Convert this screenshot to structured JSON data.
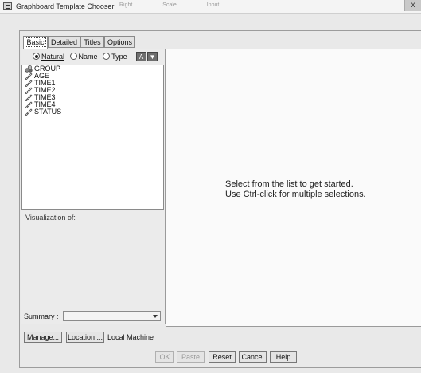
{
  "window": {
    "title": "Graphboard Template Chooser",
    "close_label": "x",
    "background_headers": [
      "Right",
      "Scale",
      "Input"
    ]
  },
  "tabs": [
    {
      "label": "Basic",
      "active": true
    },
    {
      "label": "Detailed",
      "active": false
    },
    {
      "label": "Titles",
      "active": false
    },
    {
      "label": "Options",
      "active": false
    }
  ],
  "sort": {
    "natural_label": "Natural",
    "name_label": "Name",
    "type_label": "Type",
    "selected": "Natural",
    "button_a": "A",
    "button_b": "▼"
  },
  "variables": [
    {
      "name": "GROUP",
      "icon": "nominal-icon"
    },
    {
      "name": "AGE",
      "icon": "scale-icon"
    },
    {
      "name": "TIME1",
      "icon": "scale-icon"
    },
    {
      "name": "TIME2",
      "icon": "scale-icon"
    },
    {
      "name": "TIME3",
      "icon": "scale-icon"
    },
    {
      "name": "TIME4",
      "icon": "scale-icon"
    },
    {
      "name": "STATUS",
      "icon": "scale-icon"
    }
  ],
  "visualization_label": "Visualization of:",
  "summary": {
    "label": "Summary :",
    "value": ""
  },
  "message": {
    "line1": "Select from the list to get started.",
    "line2": "Use Ctrl-click for multiple selections."
  },
  "buttons": {
    "manage": "Manage...",
    "location": "Location ...",
    "location_text": "Local Machine",
    "ok": "OK",
    "paste": "Paste",
    "reset": "Reset",
    "cancel": "Cancel",
    "help": "Help"
  }
}
